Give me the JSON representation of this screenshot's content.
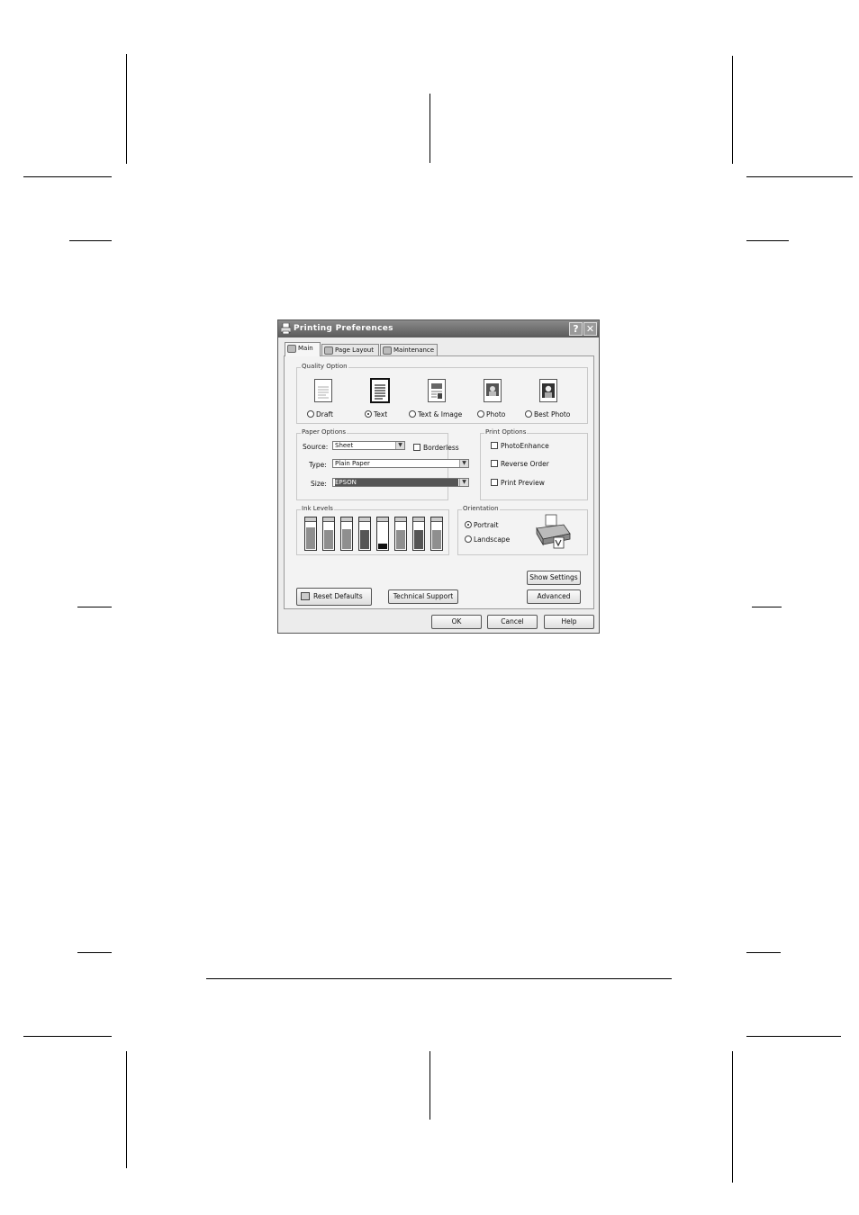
{
  "dialog": {
    "title": "Printing Preferences",
    "help_glyph": "?",
    "close_glyph": "✕",
    "tabs": [
      {
        "label": "Main",
        "icon": "printer-icon"
      },
      {
        "label": "Page Layout",
        "icon": "page-layout-icon"
      },
      {
        "label": "Maintenance",
        "icon": "maintenance-icon"
      }
    ],
    "quality": {
      "legend": "Quality Option",
      "options": [
        {
          "label": "Draft",
          "checked": false
        },
        {
          "label": "Text",
          "checked": true
        },
        {
          "label": "Text & Image",
          "checked": false
        },
        {
          "label": "Photo",
          "checked": false
        },
        {
          "label": "Best Photo",
          "checked": false
        }
      ]
    },
    "paper": {
      "legend": "Paper Options",
      "source_label": "Source:",
      "source_value": "Sheet",
      "borderless_label": "Borderless",
      "type_label": "Type:",
      "type_value": "Plain Paper",
      "size_label": "Size:",
      "size_value": "EPSON"
    },
    "print_options": {
      "legend": "Print Options",
      "items": [
        "PhotoEnhance",
        "Reverse Order",
        "Print Preview"
      ]
    },
    "ink": {
      "legend": "Ink Levels",
      "levels": [
        0.75,
        0.65,
        0.7,
        0.65,
        0.2,
        0.65,
        0.65,
        0.65
      ],
      "dark": [
        false,
        false,
        false,
        true,
        true,
        false,
        true,
        false
      ]
    },
    "orientation": {
      "legend": "Orientation",
      "options": [
        {
          "label": "Portrait",
          "checked": true
        },
        {
          "label": "Landscape",
          "checked": false
        }
      ]
    },
    "buttons": {
      "show_settings": "Show Settings",
      "advanced": "Advanced",
      "reset_defaults": "Reset Defaults",
      "technical_support": "Technical Support",
      "ok": "OK",
      "cancel": "Cancel",
      "help": "Help"
    }
  }
}
